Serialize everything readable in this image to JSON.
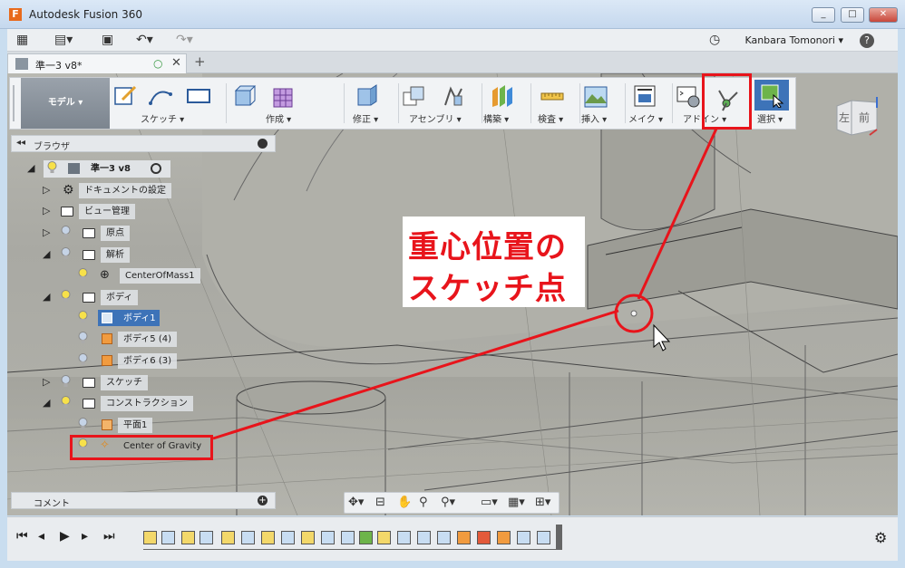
{
  "window": {
    "title": "Autodesk Fusion 360",
    "app_icon_letter": "F",
    "minimize": "_",
    "maximize": "□",
    "close": "✕"
  },
  "toolbar": {
    "user_name": "Kanbara Tomonori",
    "help": "?"
  },
  "tabs": {
    "doc_name": "準一3 v8*",
    "close": "✕",
    "add": "+"
  },
  "ribbon": {
    "workspace": "モデル",
    "groups": [
      "スケッチ",
      "作成",
      "修正",
      "アセンブリ",
      "構築",
      "検査",
      "挿入",
      "メイク",
      "アドイン",
      "選択"
    ]
  },
  "browser": {
    "title": "ブラウザ",
    "root": "準一3 v8",
    "nodes": [
      "ドキュメントの設定",
      "ビュー管理",
      "原点",
      "解析",
      "CenterOfMass1",
      "ボディ",
      "ボディ1",
      "ボディ5 (4)",
      "ボディ6 (3)",
      "スケッチ",
      "コンストラクション",
      "平面1",
      "Center of Gravity"
    ]
  },
  "comment": {
    "title": "コメント"
  },
  "viewcube": {
    "left": "左",
    "front": "前"
  },
  "annotation": {
    "line1": "重心位置の",
    "line2": "スケッチ点"
  },
  "colors": {
    "annotation_red": "#e8141b",
    "selection_blue": "#3d73b8",
    "accent_orange": "#e86a1c"
  }
}
